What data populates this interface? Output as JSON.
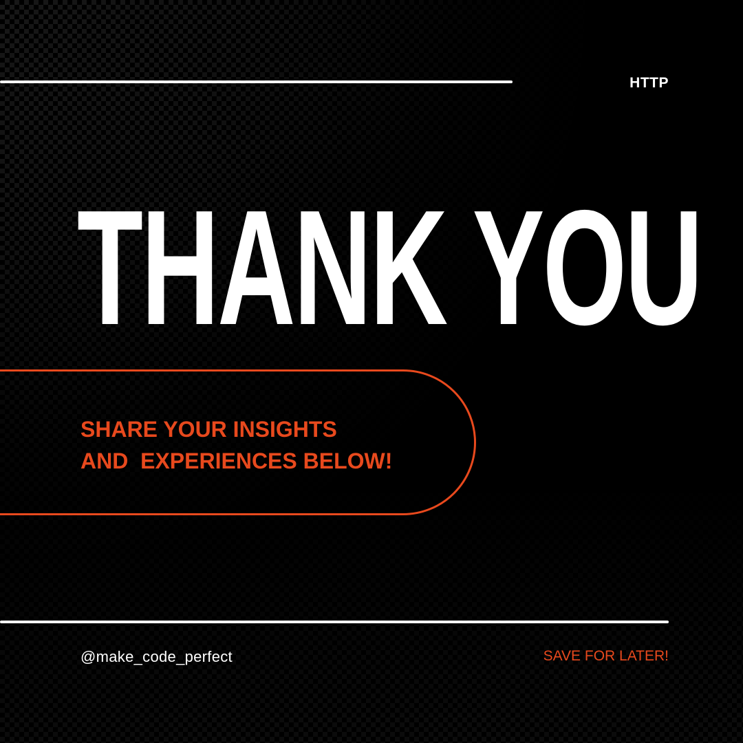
{
  "colors": {
    "background": "#000000",
    "text": "#ffffff",
    "accent": "#e8491d"
  },
  "header": {
    "topic": "HTTP"
  },
  "main": {
    "headline": "THANK YOU",
    "cta_line1": "SHARE YOUR INSIGHTS",
    "cta_line2": "AND  EXPERIENCES BELOW!"
  },
  "footer": {
    "handle": "@make_code_perfect",
    "save": "SAVE FOR LATER!"
  }
}
